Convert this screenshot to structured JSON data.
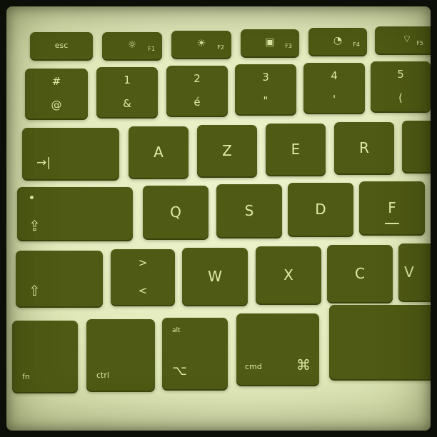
{
  "keyboard": {
    "function_row": [
      {
        "label": "esc"
      },
      {
        "glyph": "☼",
        "num": "F1"
      },
      {
        "glyph": "☀",
        "num": "F2"
      },
      {
        "glyph": "▣",
        "num": "F3"
      },
      {
        "glyph": "◔",
        "num": "F4"
      },
      {
        "glyph": "⌔",
        "num": "F5"
      }
    ],
    "number_row": [
      {
        "top": "#",
        "bottom": "@"
      },
      {
        "top": "1",
        "bottom": "&"
      },
      {
        "top": "2",
        "bottom": "é"
      },
      {
        "top": "3",
        "bottom": "\""
      },
      {
        "top": "4",
        "bottom": "'"
      },
      {
        "top": "5",
        "bottom": "("
      }
    ],
    "tab_glyph": "→|",
    "row_azer": [
      "A",
      "Z",
      "E",
      "R"
    ],
    "caps_glyph": "⇪",
    "row_qsdf": [
      "Q",
      "S",
      "D",
      "F"
    ],
    "shift_glyph": "⇧",
    "angle_key": {
      "top": ">",
      "bottom": "<"
    },
    "row_wxcv": [
      "W",
      "X",
      "C",
      "V"
    ],
    "modifiers": {
      "fn": "fn",
      "ctrl": "ctrl",
      "alt_top": "alt",
      "alt_glyph": "⌥",
      "cmd_label": "cmd",
      "cmd_glyph": "⌘"
    }
  }
}
